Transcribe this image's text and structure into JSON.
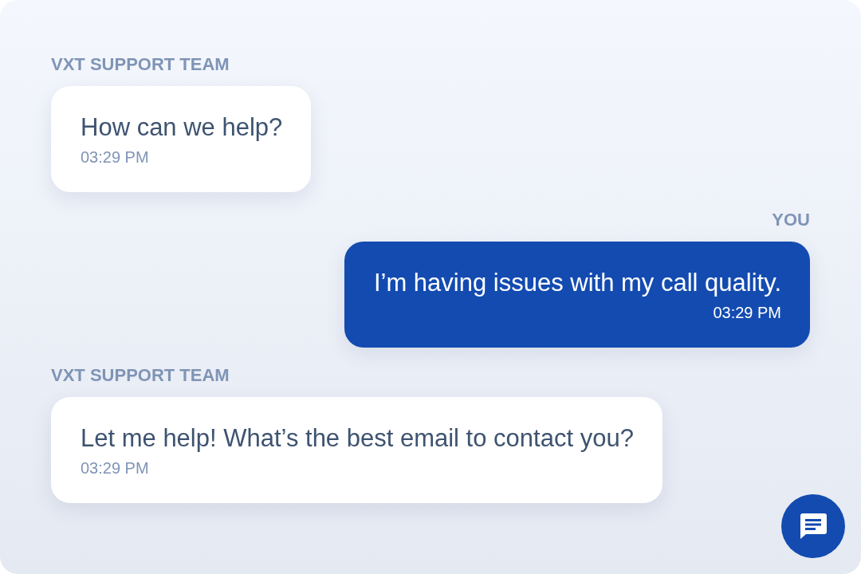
{
  "messages": [
    {
      "sender": "VXT SUPPORT TEAM",
      "kind": "agent",
      "text": "How can we help?",
      "time": "03:29 PM"
    },
    {
      "sender": "YOU",
      "kind": "user",
      "text": "I’m having issues with my call quality.",
      "time": "03:29 PM"
    },
    {
      "sender": "VXT SUPPORT TEAM",
      "kind": "agent",
      "text": "Let me help! What’s the best email to contact you?",
      "time": "03:29 PM"
    }
  ]
}
